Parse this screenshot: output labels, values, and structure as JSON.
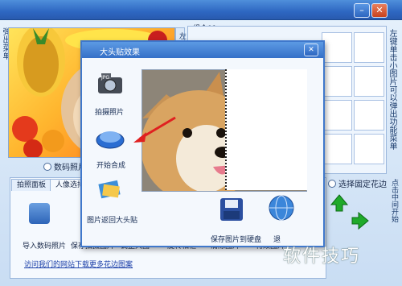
{
  "left_hint": "左键可以移动和缩放人物照片右键弹出菜单",
  "right_hint": "左键单击小图片可以弹出功能菜单",
  "group_label": "组合01",
  "mode_left": "数码照片模式",
  "mode_right": "选择固定花边",
  "tabs": [
    "拍照面板",
    "人像选择面"
  ],
  "tools": [
    {
      "label": "导入数码照片",
      "icon": "camera-import-icon"
    },
    {
      "label": "保存拍摄图片",
      "icon": "save-icon"
    },
    {
      "label": "调整大图",
      "icon": "resize-icon"
    },
    {
      "label": "旋转相框",
      "icon": "rotate-icon"
    },
    {
      "label": "清除图片",
      "icon": "clear-icon"
    },
    {
      "label": "特效图片",
      "icon": "effects-icon"
    }
  ],
  "link_text": "访问我们的网站下载更多花边图案",
  "right_side_label": "点击中间开始",
  "dialog": {
    "title": "大头贴效果",
    "items": [
      {
        "label": "拍摄照片",
        "icon": "camera-icon"
      },
      {
        "label": "开始合成",
        "icon": "start-compose-icon"
      },
      {
        "label": "图片返回大头贴",
        "icon": "back-to-photo-icon"
      }
    ],
    "save_label": "保存图片到硬盘",
    "exit_label": "退"
  },
  "watermark": "软件技巧",
  "colors": {
    "titlebar": "#2e67c2",
    "accent_red": "#e02020",
    "arrow_green": "#1faa2a"
  }
}
